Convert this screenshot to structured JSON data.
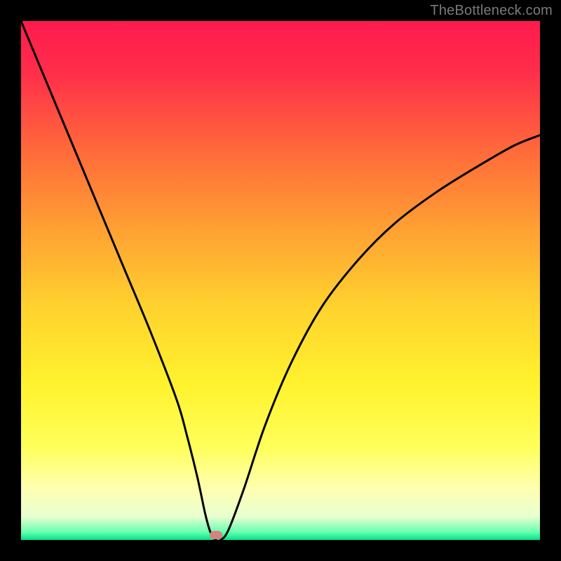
{
  "watermark": "TheBottleneck.com",
  "colors": {
    "frame": "#000000",
    "gradient_stops": [
      {
        "offset": 0.0,
        "color": "#ff1a4f"
      },
      {
        "offset": 0.1,
        "color": "#ff2e4a"
      },
      {
        "offset": 0.25,
        "color": "#ff6a3a"
      },
      {
        "offset": 0.4,
        "color": "#ffa033"
      },
      {
        "offset": 0.55,
        "color": "#ffd22e"
      },
      {
        "offset": 0.7,
        "color": "#fff22e"
      },
      {
        "offset": 0.82,
        "color": "#ffff5a"
      },
      {
        "offset": 0.9,
        "color": "#ffffb0"
      },
      {
        "offset": 0.955,
        "color": "#e8ffd0"
      },
      {
        "offset": 0.985,
        "color": "#66ffb0"
      },
      {
        "offset": 1.0,
        "color": "#00e089"
      }
    ],
    "curve": "#000000",
    "marker": "#d98080"
  },
  "marker": {
    "x_pct": 37.5,
    "y_pct": 99.0
  },
  "chart_data": {
    "type": "line",
    "title": "",
    "xlabel": "",
    "ylabel": "",
    "xlim": [
      0,
      100
    ],
    "ylim": [
      0,
      100
    ],
    "x": [
      0,
      5,
      10,
      15,
      20,
      25,
      30,
      32,
      34,
      35.5,
      36.5,
      37.5,
      38.5,
      40,
      43,
      47,
      52,
      58,
      65,
      72,
      80,
      88,
      95,
      100
    ],
    "values": [
      100,
      88,
      76,
      64,
      52,
      40,
      27,
      20,
      12,
      5,
      1.5,
      0,
      0,
      2,
      10,
      22,
      34,
      45,
      54,
      61,
      67,
      72,
      76,
      78
    ],
    "series": [
      {
        "name": "bottleneck-curve",
        "values": [
          100,
          88,
          76,
          64,
          52,
          40,
          27,
          20,
          12,
          5,
          1.5,
          0,
          0,
          2,
          10,
          22,
          34,
          45,
          54,
          61,
          67,
          72,
          76,
          78
        ]
      }
    ],
    "annotations": [
      {
        "name": "optimal-point",
        "x": 37.5,
        "y": 0
      }
    ]
  }
}
